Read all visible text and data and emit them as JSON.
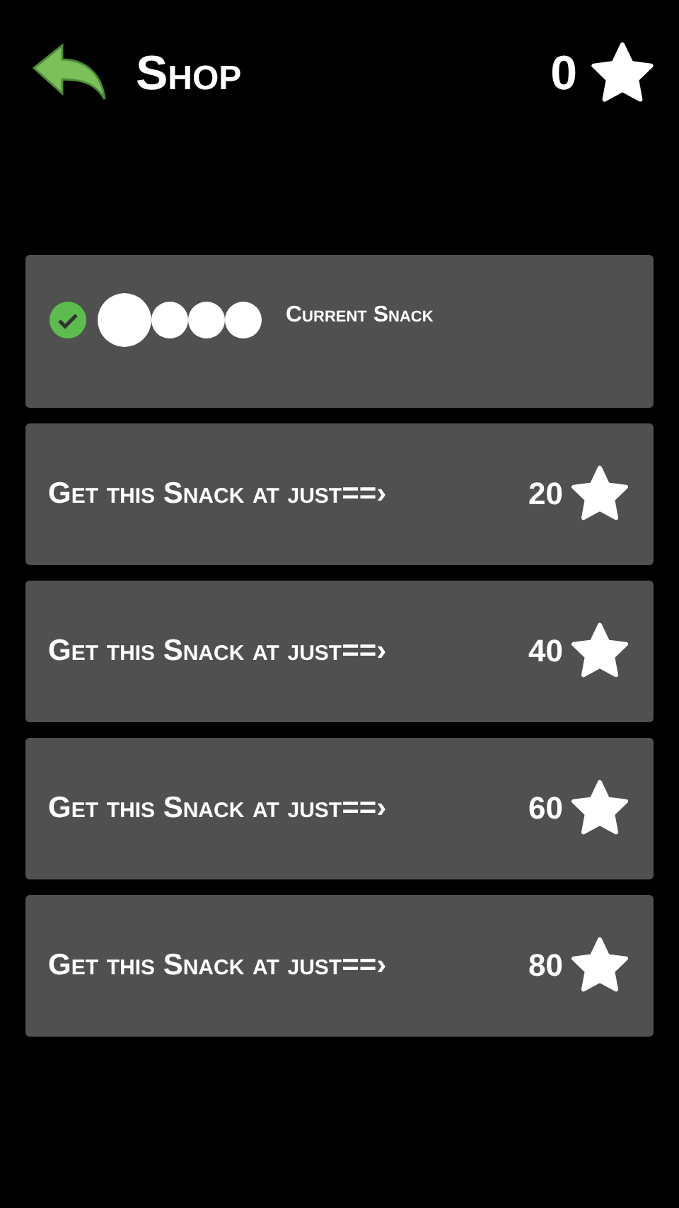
{
  "header": {
    "title": "Shop",
    "stars": "0"
  },
  "snacks": [
    {
      "kind": "current",
      "selected": true,
      "label": "Current Snack"
    },
    {
      "kind": "offer",
      "label": "Get this Snack at just==›",
      "price": "20"
    },
    {
      "kind": "offer",
      "label": "Get this Snack at just==›",
      "price": "40"
    },
    {
      "kind": "offer",
      "label": "Get this Snack at just==›",
      "price": "60"
    },
    {
      "kind": "offer",
      "label": "Get this Snack at just==›",
      "price": "80"
    }
  ]
}
